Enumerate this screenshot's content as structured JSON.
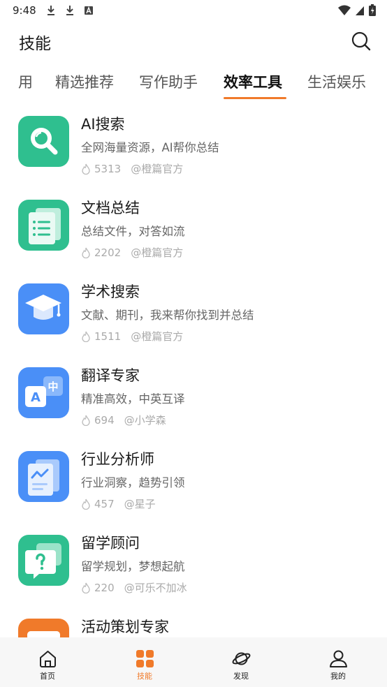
{
  "status_bar": {
    "time": "9:48"
  },
  "header": {
    "title": "技能"
  },
  "tabs": [
    {
      "label": "用"
    },
    {
      "label": "精选推荐"
    },
    {
      "label": "写作助手"
    },
    {
      "label": "效率工具",
      "active": true
    },
    {
      "label": "生活娱乐"
    }
  ],
  "skills": [
    {
      "title": "AI搜索",
      "desc": "全网海量资源，AI帮你总结",
      "count": "5313",
      "author": "@橙篇官方",
      "icon": "search-icon",
      "color": "#2fbf8f"
    },
    {
      "title": "文档总结",
      "desc": "总结文件，对答如流",
      "count": "2202",
      "author": "@橙篇官方",
      "icon": "document-list-icon",
      "color": "#2fbf8f"
    },
    {
      "title": "学术搜索",
      "desc": "文献、期刊，我来帮你找到并总结",
      "count": "1511",
      "author": "@橙篇官方",
      "icon": "graduation-cap-icon",
      "color": "#4a8ff7"
    },
    {
      "title": "翻译专家",
      "desc": "精准高效，中英互译",
      "count": "694",
      "author": "@小学森",
      "icon": "translate-icon",
      "color": "#4a8ff7"
    },
    {
      "title": "行业分析师",
      "desc": "行业洞察，趋势引领",
      "count": "457",
      "author": "@星子",
      "icon": "trend-chart-icon",
      "color": "#4a8ff7"
    },
    {
      "title": "留学顾问",
      "desc": "留学规划，梦想起航",
      "count": "220",
      "author": "@可乐不加冰",
      "icon": "question-bubble-icon",
      "color": "#2fbf8f"
    },
    {
      "title": "活动策划专家",
      "desc": "",
      "count": "",
      "author": "",
      "icon": "calendar-icon",
      "color": "#f07a2a"
    }
  ],
  "bottom_nav": [
    {
      "label": "首页",
      "icon": "home-icon"
    },
    {
      "label": "技能",
      "icon": "grid-icon",
      "active": true
    },
    {
      "label": "发现",
      "icon": "planet-icon"
    },
    {
      "label": "我的",
      "icon": "person-icon"
    }
  ],
  "colors": {
    "accent": "#f07a2a",
    "green": "#2fbf8f",
    "blue": "#4a8ff7"
  }
}
